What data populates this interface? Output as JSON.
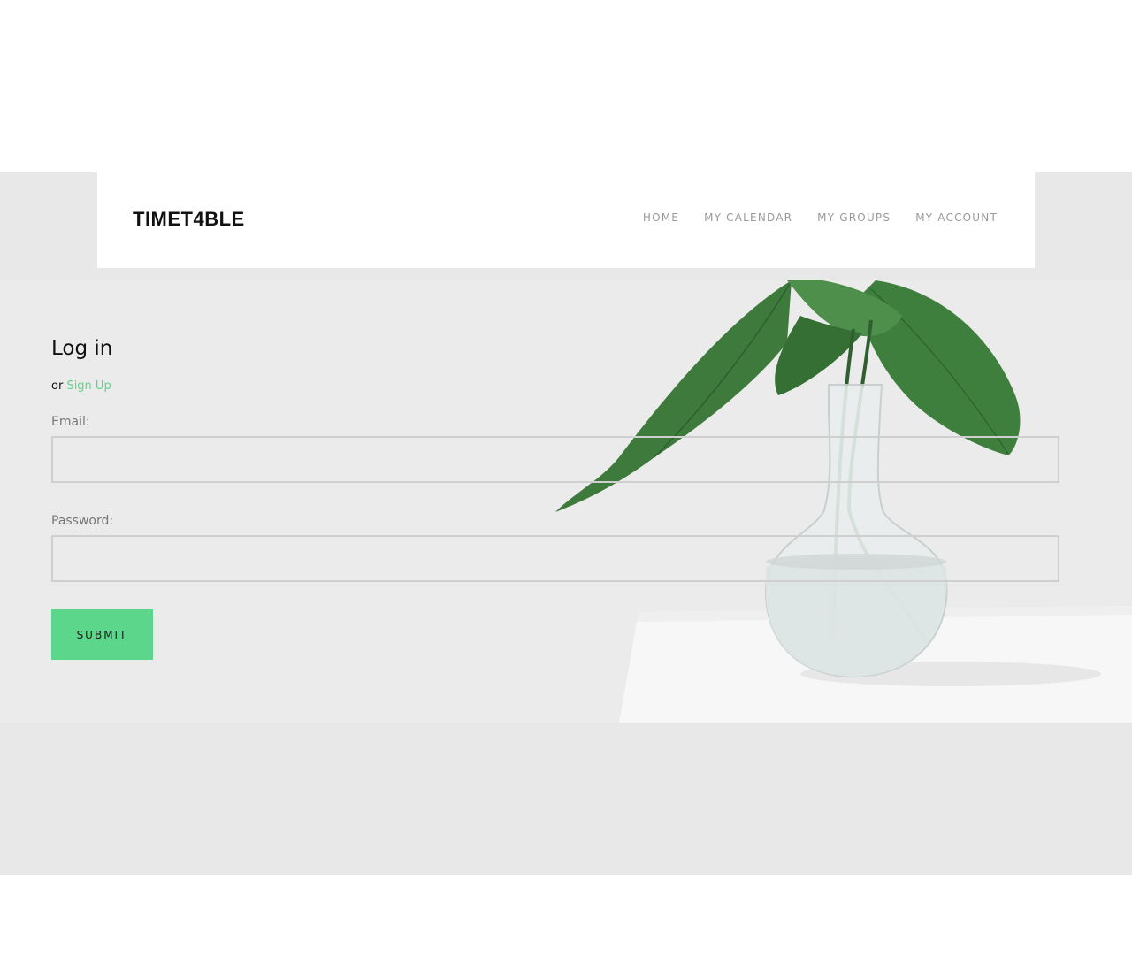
{
  "brand": {
    "name": "TIMET4BLE"
  },
  "nav": {
    "items": [
      {
        "label": "HOME"
      },
      {
        "label": "MY CALENDAR"
      },
      {
        "label": "MY GROUPS"
      },
      {
        "label": "MY ACCOUNT"
      }
    ]
  },
  "login": {
    "title": "Log in",
    "alt_prefix": "or ",
    "signup_label": "Sign Up",
    "email_label": "Email:",
    "email_value": "",
    "password_label": "Password:",
    "password_value": "",
    "submit_label": "SUBMIT"
  },
  "colors": {
    "accent": "#5cd68a",
    "band": "#e8e8e8",
    "hero_bg": "#ebebeb",
    "nav_text": "#9a9a9a"
  },
  "hero_image": {
    "icon": "plant-vase-photo"
  }
}
